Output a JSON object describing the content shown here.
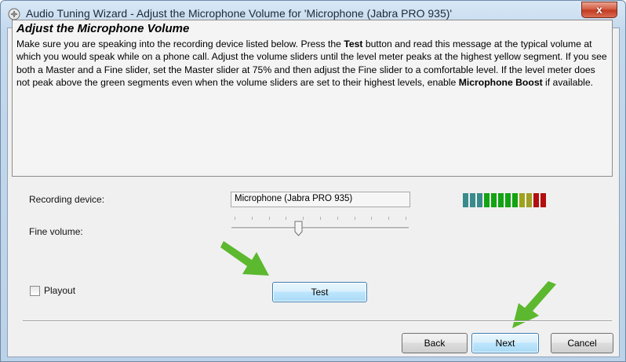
{
  "window": {
    "title": "Audio Tuning Wizard - Adjust the Microphone Volume for 'Microphone (Jabra PRO 935)'",
    "close_label": "x"
  },
  "header": {
    "heading": "Adjust the Microphone Volume",
    "text_1": "Make sure you are speaking into the recording device listed below. Press the ",
    "text_bold_1": "Test",
    "text_2": " button and read this message at the typical volume at which you would speak while on a phone call. Adjust the volume sliders until the level meter peaks at the highest yellow segment. If you see both a Master and a Fine slider, set the Master slider at 75% and then adjust the Fine slider to a comfortable level. If the level meter does not peak above the green segments even when the volume sliders are set to their highest levels, enable ",
    "text_bold_2": "Microphone Boost",
    "text_3": " if available."
  },
  "form": {
    "recording_device_label": "Recording device:",
    "recording_device_value": "Microphone (Jabra PRO 935)",
    "fine_volume_label": "Fine volume:",
    "fine_volume_level": 0.38,
    "playout_label": "Playout",
    "playout_checked": false,
    "test_button": "Test"
  },
  "level_meter": {
    "segments": [
      "#3a8b8c",
      "#3a8b8c",
      "#3a8b8c",
      "#13a313",
      "#13a313",
      "#13a313",
      "#13a313",
      "#13a313",
      "#9ea31a",
      "#a0a025",
      "#b30f0f",
      "#b30f0f"
    ]
  },
  "footer": {
    "back_button": "Back",
    "next_button": "Next",
    "cancel_button": "Cancel"
  },
  "colors": {
    "arrow_green": "#5cb82e",
    "accent_blue": "#3c7fb1"
  }
}
